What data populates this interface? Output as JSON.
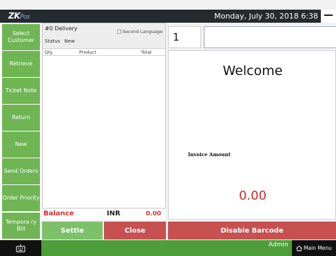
{
  "titlebar": {
    "logo_main": "ZK",
    "logo_sub": "Pos",
    "datetime": "Monday, July 30, 2018 6:38",
    "minimize_glyph": "—"
  },
  "sidebar": {
    "items": [
      {
        "label": "Select Customer"
      },
      {
        "label": "Retrieve"
      },
      {
        "label": "Ticket Note"
      },
      {
        "label": "Return"
      },
      {
        "label": "New"
      },
      {
        "label": "Send Orders"
      },
      {
        "label": "Order Priority"
      },
      {
        "label": "Tempora ry Bill"
      }
    ]
  },
  "ticket": {
    "name": "#0 Delivery",
    "status_label": "Status",
    "status_value": "New",
    "second_language": "Second Language",
    "columns": {
      "qty": "Qty",
      "product": "Product",
      "total": "Total"
    },
    "rows": []
  },
  "balance": {
    "label": "Balance",
    "currency": "INR",
    "amount": "0.00"
  },
  "input": {
    "quantity": "1",
    "barcode": ""
  },
  "display": {
    "welcome": "Welcome",
    "invoice_label": "Invoice Amount",
    "invoice_amount": "0.00"
  },
  "buttons": {
    "settle": "Settle",
    "close": "Close",
    "disable_barcode": "Disable Barcode"
  },
  "statusbar": {
    "user": "Admin",
    "main_menu": "Main Menu"
  },
  "colors": {
    "green": "#6fb554",
    "red": "#c75050",
    "titlebar": "#252a2e",
    "statusbar": "#4d9d3a"
  }
}
